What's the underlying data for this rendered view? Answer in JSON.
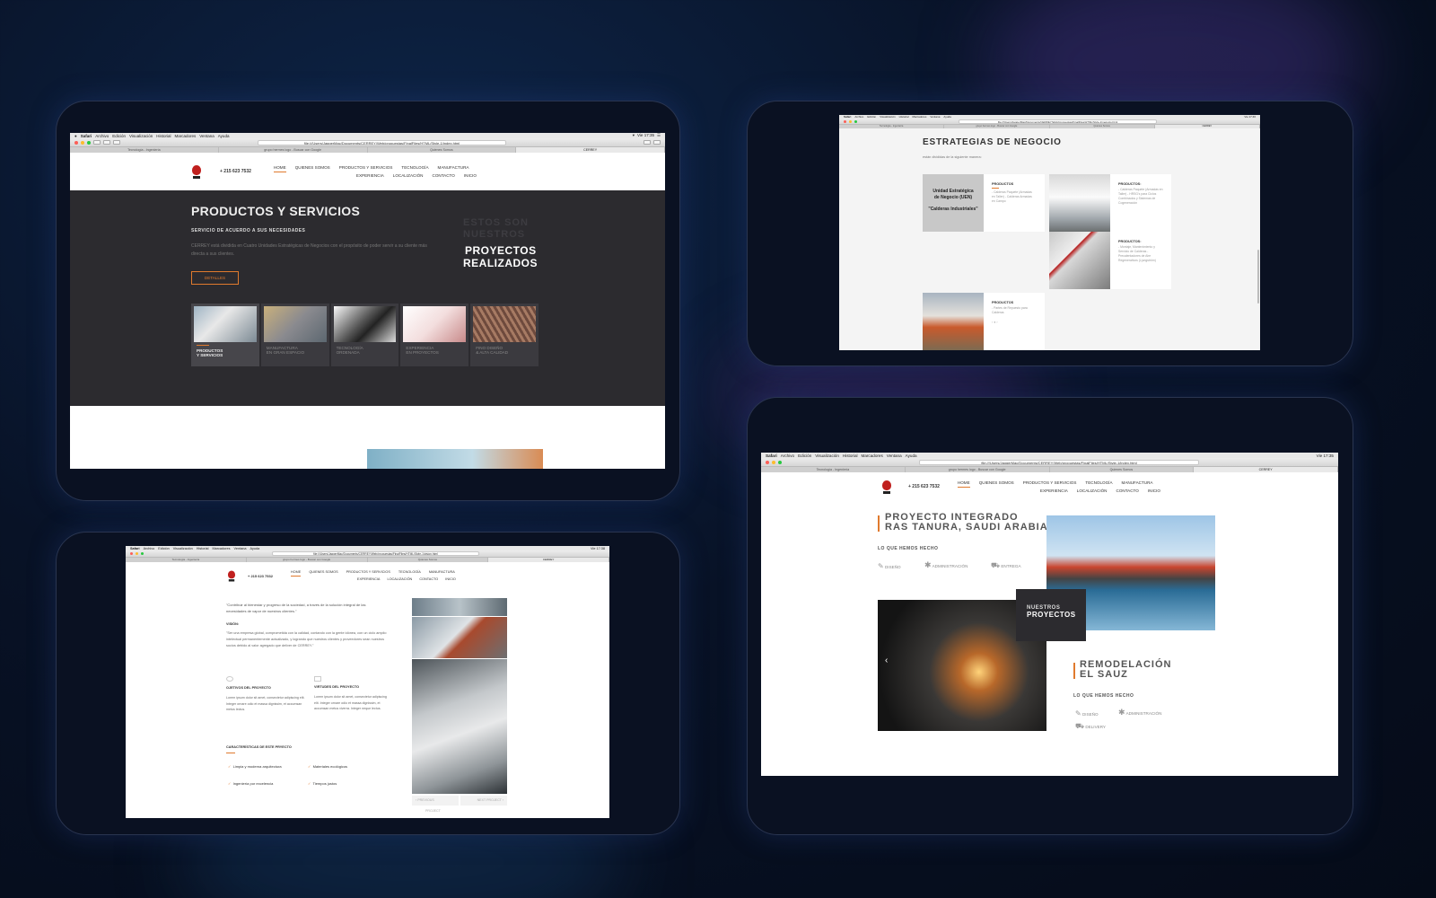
{
  "browser": {
    "menubar": {
      "apple": "",
      "app": "Safari",
      "items": [
        "Archivo",
        "Edición",
        "Visualización",
        "Historial",
        "Marcadores",
        "Ventana",
        "Ayuda"
      ],
      "clock_a": "Vie 17:35",
      "clock_b": "Vie 17:46",
      "clock_c": "Vie 17:38"
    },
    "url_index": "file:///Users/JaggerMac/Documents/CERREY/Web/propuestas/FinalFiles/HTML/Style-1/index.html",
    "url_negocio": "file:///Users/JaggerMac/Documents/CERREY/Web/propuestas/FinalFiles/HTML/Style-1/negocio.html",
    "url_vision": "file:///Users/JaggerMac/Documents/CERREY/Web/propuestas/FinalFiles/HTML/Style-1/vision.html",
    "tabs": [
      "Tecnología - Ingeniería",
      "grupo hermes logo - Buscar con Google",
      "Quienes Somos",
      "CERREY"
    ]
  },
  "site": {
    "phone": "+ 215 623 7532",
    "nav_row1": [
      "HOME",
      "QUIENES SOMOS",
      "PRODUCTOS Y SERVICIOS",
      "TECNOLOGÍA",
      "MANUFACTURA"
    ],
    "nav_row2": [
      "EXPERIENCIA",
      "LOCALIZACIÓN",
      "CONTACTO",
      "INICIO"
    ]
  },
  "screen1": {
    "title": "PRODUCTOS Y SERVICIOS",
    "subtitle": "SERVICIO DE ACUERDO A SUS NECESIDADES",
    "body": "CERREY está dividida en Cuatro Unidades Estratégicas de Negocios con el propósito de poder servir a su cliente más directa a sus clientes.",
    "button": "DETALLES",
    "overlay_faded": "ESTOS SON NUESTROS",
    "overlay_bold1": "PROYECTOS",
    "overlay_bold2": "REALIZADOS",
    "cards": [
      {
        "l1": "PRODUCTOS",
        "l2": "Y SERVICIOS"
      },
      {
        "l1": "MANUFACTURA",
        "l2": "EN GRAN ESPACIO"
      },
      {
        "l1": "TECNOLOGÍA",
        "l2": "ORDENADA"
      },
      {
        "l1": "EXPERIENCIA",
        "l2": "EN PROYECTOS"
      },
      {
        "l1": "FINO DISEÑO",
        "l2": "& ALTA CALIDAD"
      }
    ]
  },
  "screen2": {
    "title": "ESTRATEGIAS DE NEGOCIO",
    "subtitle": "están divididas de la siguiente manera:",
    "uen_l1": "Unidad Estratégica",
    "uen_l2": "de Negocio (UEN)",
    "uen_l3": "\"Calderas Industriales\"",
    "prod_label": "PRODUCTOS",
    "prod_label2": "PRODUCTOS:",
    "col1": "- Calderas Paquete (Armadas en Taller) - Calderas Armadas en Campo",
    "col2": "- Calderas Paquete (Armadas en Taller) - HRSG's para Ciclos Combinados y Sistemas de Cogeneración",
    "col3": "- Montaje, Mantenimiento y Servicio de Calderas - Precalentadores de Aire Regenerativos (Ljungström)",
    "col4": "- Partes de Repuesto para Calderas",
    "pager": "‹  ●  ›"
  },
  "screen3": {
    "quote": "\"Contribuir al bienestar y progreso de la sociedad, a través de la solución integral de las necesidades de vapor de nuestros clientes.\"",
    "vision_label": "VISIÓN:",
    "vision": "\"Ser una empresa global, comprometida con la calidad, contando con la gente idónea, con un ciclo amplio intelectual permanentemente actualizado, y logrando que nuestros clientes y proveedores sean nuestros socios debido al valor agregado que deliver de CERREY.\"",
    "obj_title": "OJETIVOS DEL PROYECTO",
    "obj_text": "Lorem ipsum dolor sit amet, consectetur adipiscing elit. Integer ornare odio et massa dignissim, et accumsan metus lectus.",
    "virt_title": "VIRTUDES DEL PROYECTO",
    "virt_text": "Lorem ipsum dolor sit amet, consectetur adipiscing elit. Integer ornare odio et massa dignissim, et accumsan metus viverra. Integer neque lectus.",
    "features_title": "CARACTERÍSTICAS DE ESTE PRYECTO",
    "features": [
      "Limpia y moderna arquitectura",
      "Materiales ecológicos",
      "Ingeniería por excelencia",
      "Tiempos justos"
    ],
    "prev": "‹   PREVIOUS",
    "next": "NEXT PROJECT   ›",
    "project": "PROJECT"
  },
  "screen4": {
    "proj1_l1": "PROYECTO INTEGRADO",
    "proj1_l2": "RAS TANURA, SAUDI ARABIA",
    "done_label": "LO QUE HEMOS HECHO",
    "svc": [
      "DISEÑO",
      "ADMINISTRACIÓN",
      "ENTREGA"
    ],
    "badge_l1": "NUESTROS",
    "badge_l2": "PROYECTOS",
    "proj2_l1": "REMODELACIÓN",
    "proj2_l2": "EL SAUZ",
    "svc2": [
      "DISEÑO",
      "ADMINISTRACIÓN",
      "DELIVERY"
    ]
  },
  "colors": {
    "accent": "#e07a2e",
    "dark_panel": "#2c2b2f",
    "brand_red": "#c0201e"
  }
}
